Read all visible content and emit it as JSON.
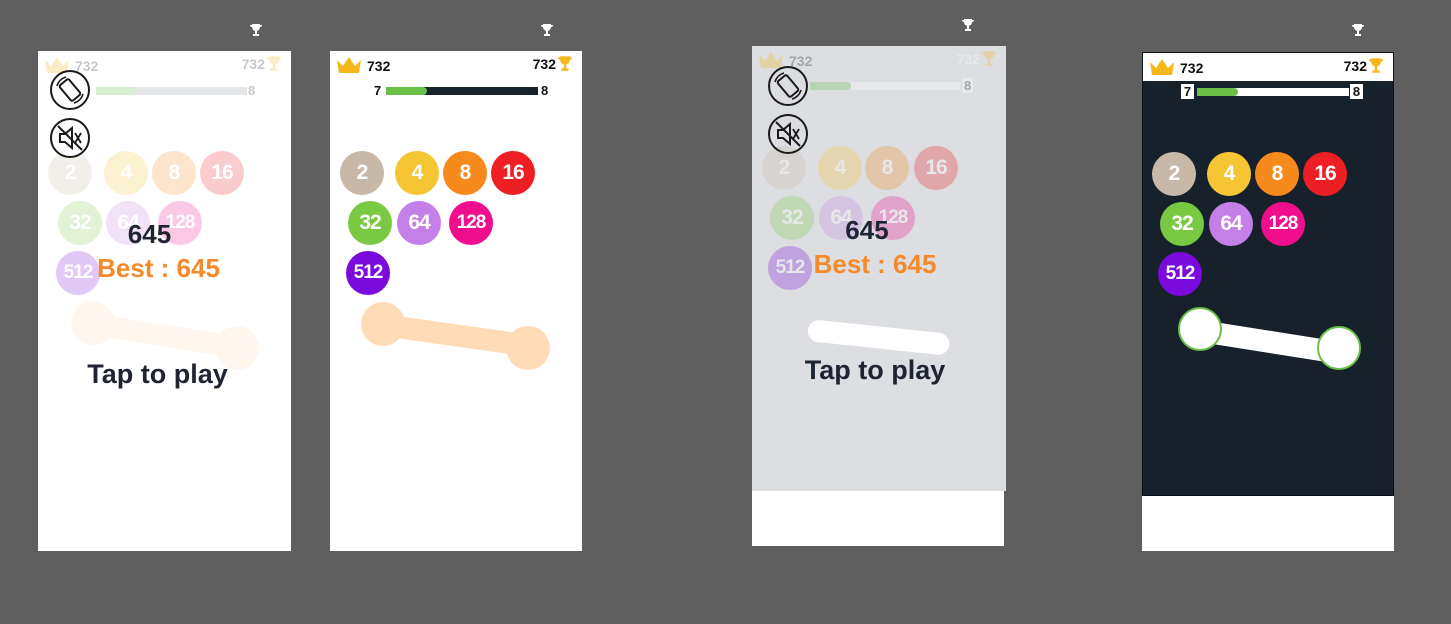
{
  "game": {
    "best_score": "732",
    "level_current": "7",
    "level_next": "8",
    "level_progress": 0.27,
    "balls": [
      "2",
      "4",
      "8",
      "16",
      "32",
      "64",
      "128",
      "512"
    ],
    "ball_colors": [
      "#c8b8a8",
      "#f5c534",
      "#f78a1c",
      "#ee1e25",
      "#7ac943",
      "#c47fe8",
      "#f00e8c",
      "#7b0bdc"
    ],
    "stick_color": "#ffdcb5",
    "overlay": {
      "score": "645",
      "best": "Best : 645",
      "tap": "Tap to play"
    }
  },
  "themes": {
    "light_bg": "#ffffff",
    "gray_bg": "#dcdee1",
    "dark_bg": "#17212b",
    "accent_green": "#6cc04a"
  },
  "icons": [
    "crown-icon",
    "trophy-icon",
    "rotate-screen-icon",
    "sound-off-icon"
  ]
}
